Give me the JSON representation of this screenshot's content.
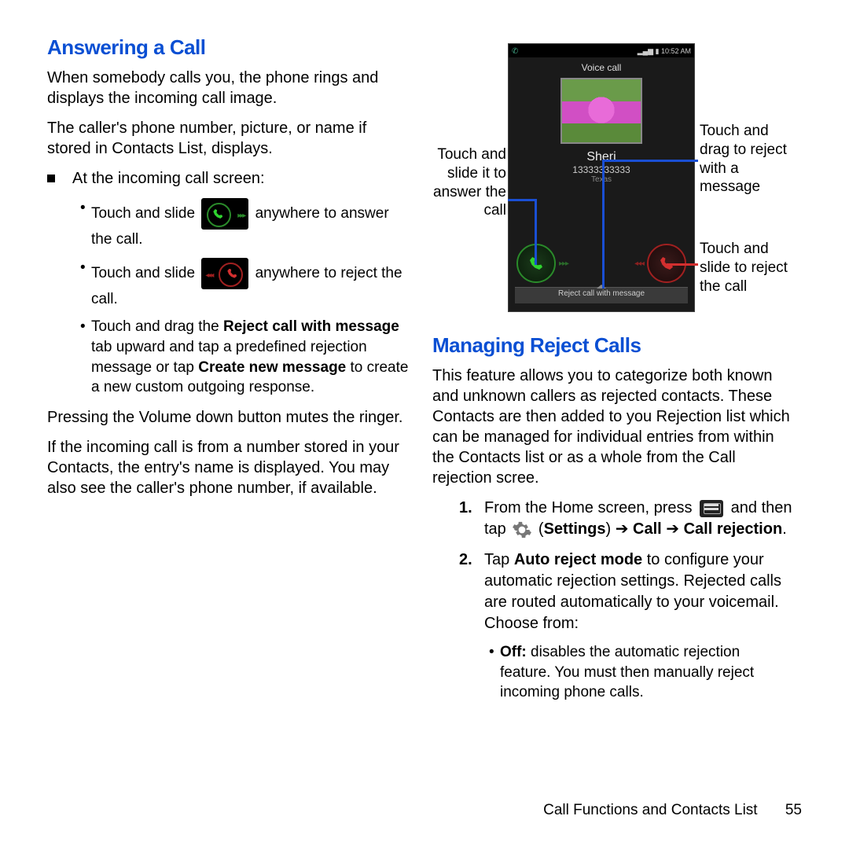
{
  "left": {
    "heading": "Answering a Call",
    "p1": "When somebody calls you, the phone rings and displays the incoming call image.",
    "p2": "The caller's phone number, picture, or name if stored in Contacts List, displays.",
    "intro": "At the incoming call screen:",
    "b1a": "Touch and slide ",
    "b1b": " anywhere to answer the call.",
    "b2a": "Touch and slide ",
    "b2b": " anywhere to reject the call.",
    "b3": "Touch and drag the ",
    "b3bold": "Reject call with message",
    "b3rest": " tab upward and tap a predefined rejection message or tap ",
    "b3bold2": "Create new message",
    "b3end": " to create a new custom outgoing response.",
    "p3": "Pressing the Volume down button mutes the ringer.",
    "p4": "If the incoming call is from a number stored in your Contacts, the entry's name is displayed. You may also see the caller's phone number, if available."
  },
  "phone": {
    "time": "10:52 AM",
    "voice": "Voice call",
    "name": "Sheri",
    "number": "13333333333",
    "location": "Texas",
    "reject_tab": "Reject call with message"
  },
  "callouts": {
    "left": "Touch and slide it to answer the call",
    "right1": "Touch and drag to reject with a message",
    "right2": "Touch and slide to reject the call"
  },
  "right": {
    "heading": "Managing Reject Calls",
    "p1": "This feature allows you to categorize both known and unknown callers as rejected contacts. These Contacts are then added to you Rejection list which can be managed for individual entries from within the Contacts list or as a whole from the Call rejection scree.",
    "s1a": "From the Home screen, press ",
    "s1b": " and then tap ",
    "s1c_paren_open": " (",
    "s1_settings": "Settings",
    "s1_arrow1": ") ➔ ",
    "s1_call": "Call",
    "s1_arrow2": " ➔ ",
    "s1_callrej": "Call rejection",
    "s1_end": ".",
    "s2a": "Tap ",
    "s2_bold": "Auto reject mode",
    "s2b": " to configure your automatic rejection settings. Rejected calls are routed automatically to your voicemail. Choose from:",
    "s2_sub_bold": "Off:",
    "s2_sub": " disables the automatic rejection feature. You must then manually reject incoming phone calls."
  },
  "footer": {
    "section": "Call Functions and Contacts List",
    "page": "55"
  }
}
